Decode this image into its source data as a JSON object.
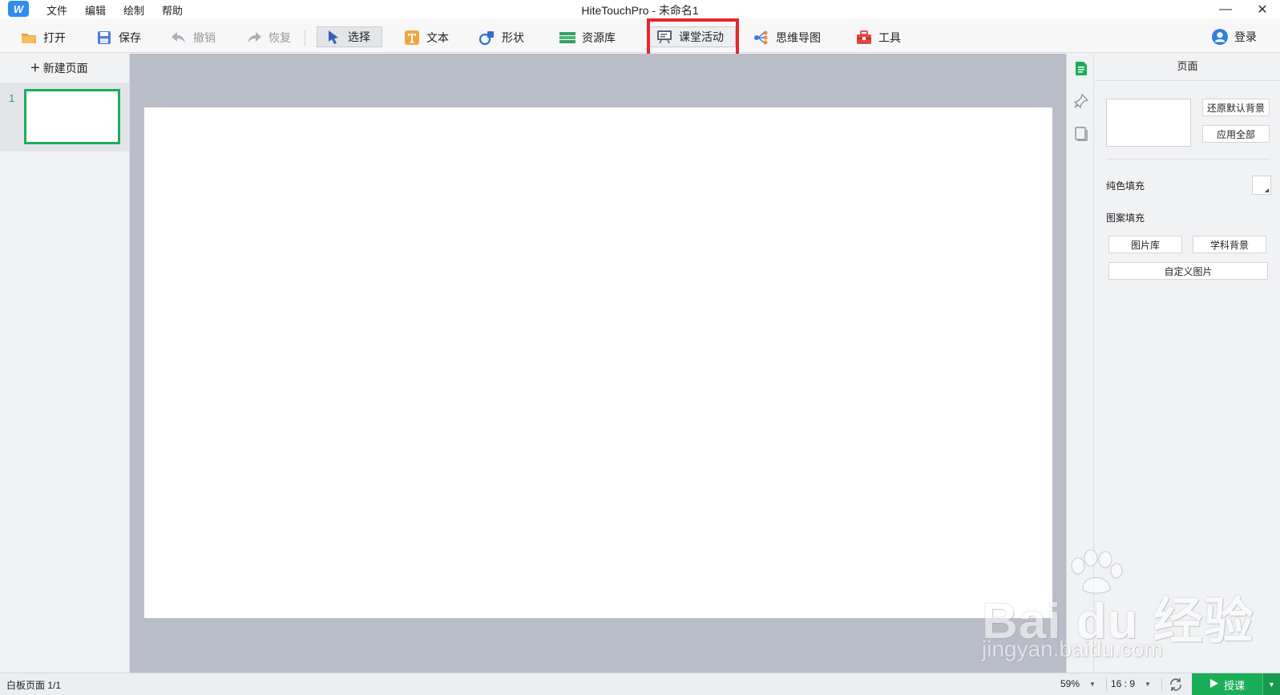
{
  "app": {
    "logo_text": "W",
    "window_title": "HiteTouchPro - 未命名1"
  },
  "menubar": {
    "items": [
      "文件",
      "编辑",
      "绘制",
      "帮助"
    ]
  },
  "window_controls": {
    "minimize": "—",
    "close": "✕"
  },
  "toolbar": {
    "open": "打开",
    "save": "保存",
    "undo": "撤销",
    "redo": "恢复",
    "select": "选择",
    "text": "文本",
    "shape": "形状",
    "resources": "资源库",
    "class_activity": "课堂活动",
    "mind_map": "思维导图",
    "tools": "工具",
    "login": "登录"
  },
  "left_panel": {
    "new_page": "新建页面",
    "pages": [
      {
        "number": "1"
      }
    ]
  },
  "right_panel": {
    "title": "页面",
    "restore_default_bg": "还原默认背景",
    "apply_all": "应用全部",
    "solid_fill": "纯色填充",
    "pattern_fill": "图案填充",
    "image_library": "图片库",
    "subject_background": "学科背景",
    "custom_image": "自定义图片"
  },
  "statusbar": {
    "page_info": "白板页面 1/1",
    "zoom": "59%",
    "aspect_ratio": "16 : 9",
    "start_class": "授课"
  },
  "watermark": {
    "brand": "Bai du 经验",
    "url": "jingyan.baidu.com"
  },
  "colors": {
    "accent_green": "#1bae59",
    "highlight_red": "#e8262c",
    "canvas_bg": "#b9bdc8"
  },
  "icons": [
    "folder-icon",
    "floppy-icon",
    "undo-icon",
    "redo-icon",
    "cursor-icon",
    "text-t-icon",
    "shape-icon",
    "resource-icon",
    "activity-icon",
    "mindmap-icon",
    "toolbox-icon",
    "user-icon",
    "page-tab-icon",
    "pin-tab-icon",
    "book-tab-icon",
    "sync-icon",
    "play-icon"
  ]
}
